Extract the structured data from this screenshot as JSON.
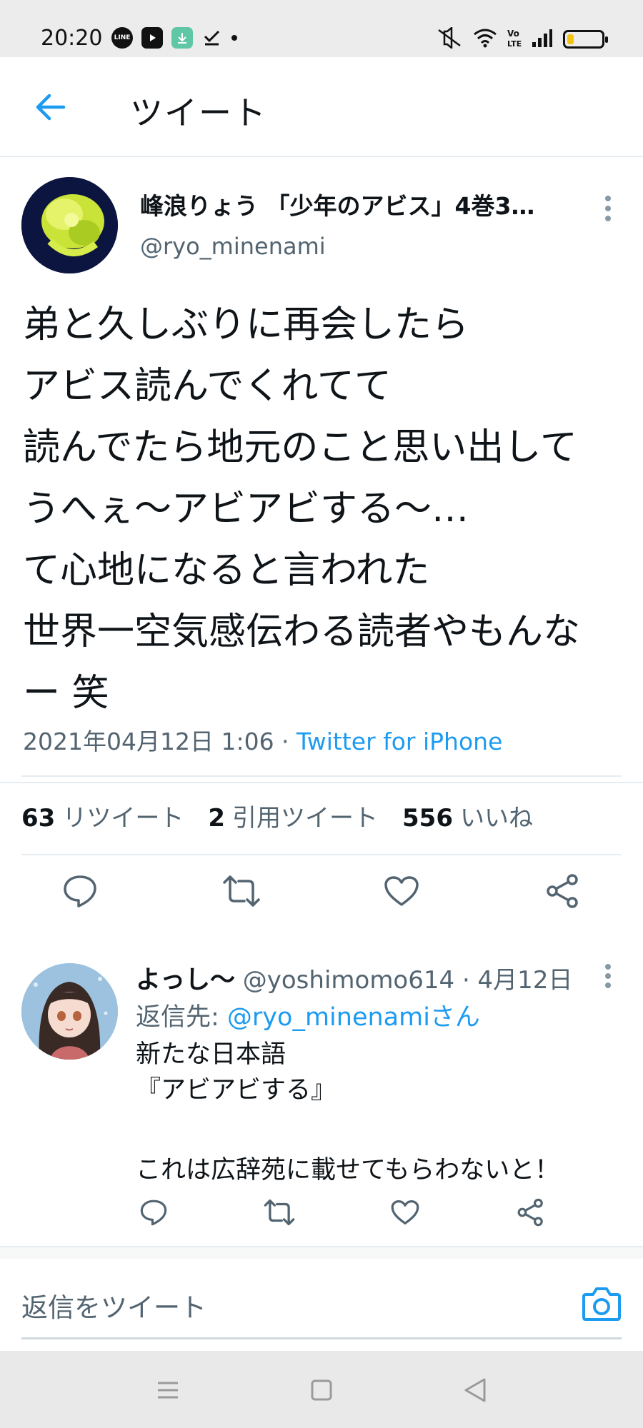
{
  "status_bar": {
    "time": "20:20",
    "left_icons": [
      "line-app-icon",
      "youtube-icon",
      "download-icon",
      "check-icon"
    ],
    "right_icons": [
      "mute-icon",
      "wifi-icon",
      "volte-icon",
      "signal-icon",
      "battery-icon"
    ],
    "battery_level": 0.2,
    "line_label": "LINE"
  },
  "header": {
    "title": "ツイート"
  },
  "tweet": {
    "author_name": "峰浪りょう 「少年のアビス」4巻3…",
    "author_handle": "@ryo_minenami",
    "text_lines": [
      "弟と久しぶりに再会したら",
      "アビス読んでくれてて",
      "読んでたら地元のこと思い出して",
      "うへぇ〜アビアビする〜…",
      "て心地になると言われた",
      "世界一空気感伝わる読者やもんな",
      "ー 笑"
    ],
    "datetime": "2021年04月12日 1:06 · ",
    "source": "Twitter for iPhone",
    "stats": {
      "retweets": "63",
      "retweets_label": "リツイート",
      "quotes": "2",
      "quotes_label": "引用ツイート",
      "likes": "556",
      "likes_label": "いいね"
    }
  },
  "reply": {
    "name": "よっし〜",
    "handle_meta": " @yoshimomo614 · 4月12日",
    "reply_to_prefix": "返信先: ",
    "reply_to_link": "@ryo_minenamiさん",
    "text_lines": [
      "新たな日本語",
      "『アビアビする』",
      "",
      "これは広辞苑に載せてもらわないと！"
    ]
  },
  "composer": {
    "placeholder": "返信をツイート"
  },
  "colors": {
    "accent": "#1d9bf0",
    "secondary_text": "#536471",
    "divider": "#e6ecf0"
  }
}
